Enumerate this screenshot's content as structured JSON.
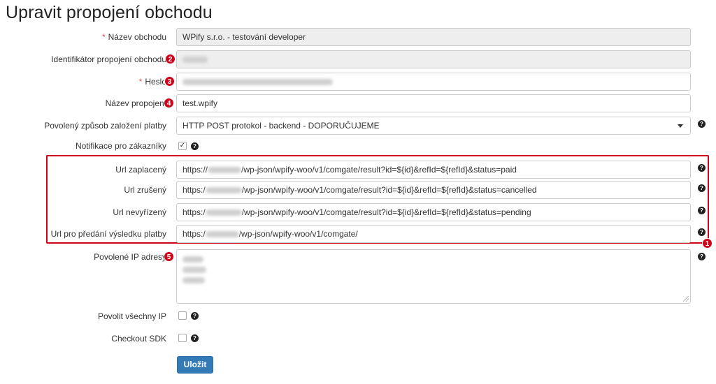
{
  "page_title": "Upravit propojení obchodu",
  "required_mark": "*",
  "fields": {
    "shop_name": {
      "label": "Název obchodu",
      "value": "WPify s.r.o. - testování developer"
    },
    "connection_id": {
      "label": "Identifikátor propojení obchodu",
      "value": ""
    },
    "password": {
      "label": "Heslo",
      "value": ""
    },
    "connection_name": {
      "label": "Název propojení",
      "value": "test.wpify"
    },
    "payment_method": {
      "label": "Povolený způsob založení platby",
      "value": "HTTP POST protokol - backend - DOPORUČUJEME"
    },
    "customer_notification": {
      "label": "Notifikace pro zákazníky",
      "checked": true,
      "check_glyph": "✓"
    },
    "url_paid": {
      "label": "Url zaplacený",
      "prefix": "https://",
      "suffix": "/wp-json/wpify-woo/v1/comgate/result?id=${id}&refId=${refId}&status=paid"
    },
    "url_cancelled": {
      "label": "Url zrušený",
      "prefix": "https:/",
      "suffix": "/wp-json/wpify-woo/v1/comgate/result?id=${id}&refId=${refId}&status=cancelled"
    },
    "url_pending": {
      "label": "Url nevyřízený",
      "prefix": "https:/",
      "suffix": "/wp-json/wpify-woo/v1/comgate/result?id=${id}&refId=${refId}&status=pending"
    },
    "url_result": {
      "label": "Url pro předání výsledku platby",
      "prefix": "https:/",
      "suffix": "/wp-json/wpify-woo/v1/comgate/"
    },
    "allowed_ips": {
      "label": "Povolené IP adresy"
    },
    "allow_all_ip": {
      "label": "Povolit všechny IP",
      "checked": false
    },
    "checkout_sdk": {
      "label": "Checkout SDK",
      "checked": false
    }
  },
  "help_glyph": "?",
  "markers": {
    "m1": "1",
    "m2": "2",
    "m3": "3",
    "m4": "4",
    "m5": "5"
  },
  "save_button": {
    "label": "Uložit"
  },
  "colors": {
    "marker": "#d0021b",
    "primary_button": "#337ab7",
    "readonly_bg": "#eeeeee",
    "required": "#d9534f"
  },
  "icons": {
    "help": "question-circle-icon",
    "dropdown": "caret-down-icon",
    "checkbox": "checkbox-icon"
  }
}
